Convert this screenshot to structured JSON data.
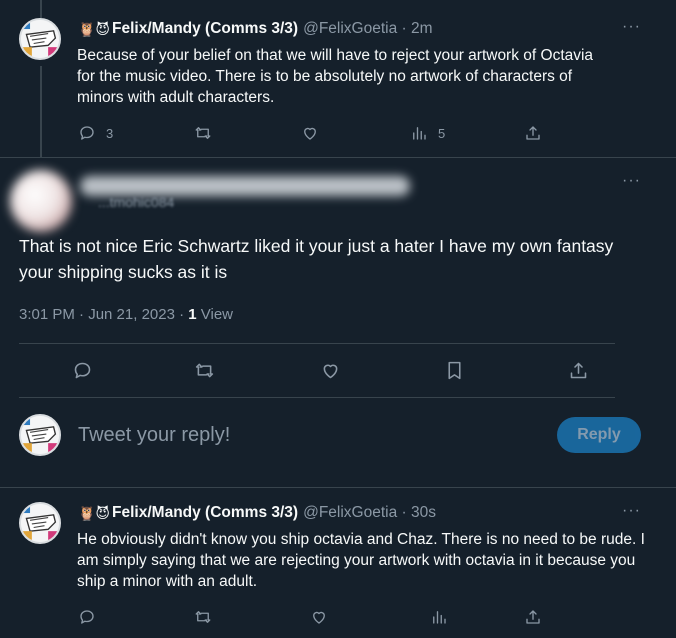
{
  "tweet1": {
    "emoji": "🦉😈",
    "display_name": "Felix/Mandy (Comms 3/3)",
    "handle_time": "@FelixGoetia · 2m",
    "text": "Because of your belief on that we will have to reject your artwork of Octavia for the music video. There is to be absolutely no artwork of characters of minors with adult characters.",
    "reply_count": "3",
    "views_count": "5",
    "more": "···"
  },
  "main_tweet": {
    "handle_partial": "...tmohic084",
    "text": "That is not nice Eric Schwartz liked it your just a hater I have my own fantasy your shipping sucks as it is",
    "timestamp": "3:01 PM · Jun 21, 2023 · ",
    "views_count": "1",
    "views_label": " View",
    "more": "···"
  },
  "composer": {
    "placeholder": "Tweet your reply!",
    "reply_button": "Reply"
  },
  "tweet2": {
    "emoji": "🦉😈",
    "display_name": "Felix/Mandy (Comms 3/3)",
    "handle_time": "@FelixGoetia · 30s",
    "text": "He obviously didn't know you ship octavia and Chaz. There is no need to be rude. I am simply saying that we are rejecting your artwork with octavia in it because you ship a minor with an adult.",
    "more": "···"
  },
  "colors": {
    "background": "#15202b",
    "text": "#f7f9f9",
    "muted": "#8b98a5",
    "divider": "#38444d",
    "reply_button": "#1a6ea8"
  },
  "icons": [
    "reply-icon",
    "retweet-icon",
    "like-icon",
    "views-icon",
    "share-icon",
    "bookmark-icon"
  ]
}
